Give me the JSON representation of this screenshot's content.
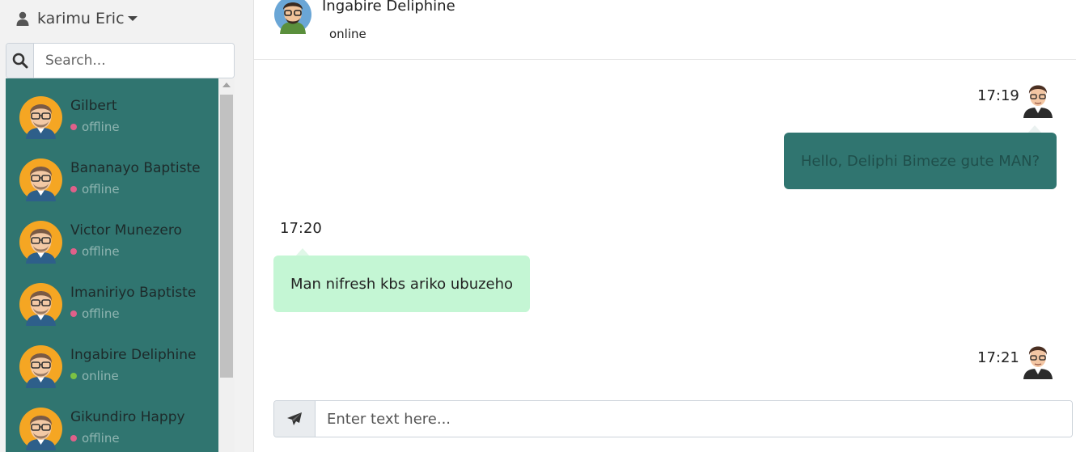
{
  "user_menu": {
    "name": "karimu Eric",
    "icon": "user-icon"
  },
  "search": {
    "placeholder": "Search...",
    "icon": "search-icon"
  },
  "colors": {
    "sidebar_list_bg": "#307570",
    "offline_dot": "#e0608a",
    "online_dot": "#7cc243",
    "outgoing_bubble": "#307570",
    "incoming_bubble": "#c4f6d4"
  },
  "contacts": [
    {
      "name": "Gilbert",
      "status": "offline"
    },
    {
      "name": "Bananayo Baptiste",
      "status": "offline"
    },
    {
      "name": "Victor Munezero",
      "status": "offline"
    },
    {
      "name": "Imaniriyo Baptiste",
      "status": "offline"
    },
    {
      "name": "Ingabire Deliphine",
      "status": "online"
    },
    {
      "name": "Gikundiro Happy",
      "status": "offline"
    }
  ],
  "chat": {
    "partner_name": "Ingabire Deliphine",
    "partner_status": "online",
    "messages": [
      {
        "direction": "outgoing",
        "time": "17:19",
        "text": "Hello, Deliphi Bimeze gute MAN?"
      },
      {
        "direction": "incoming",
        "time": "17:20",
        "text": "Man nifresh kbs ariko ubuzeho"
      },
      {
        "direction": "outgoing",
        "time": "17:21",
        "text": ""
      }
    ]
  },
  "composer": {
    "placeholder": "Enter text here...",
    "send_icon": "paper-plane-icon"
  }
}
